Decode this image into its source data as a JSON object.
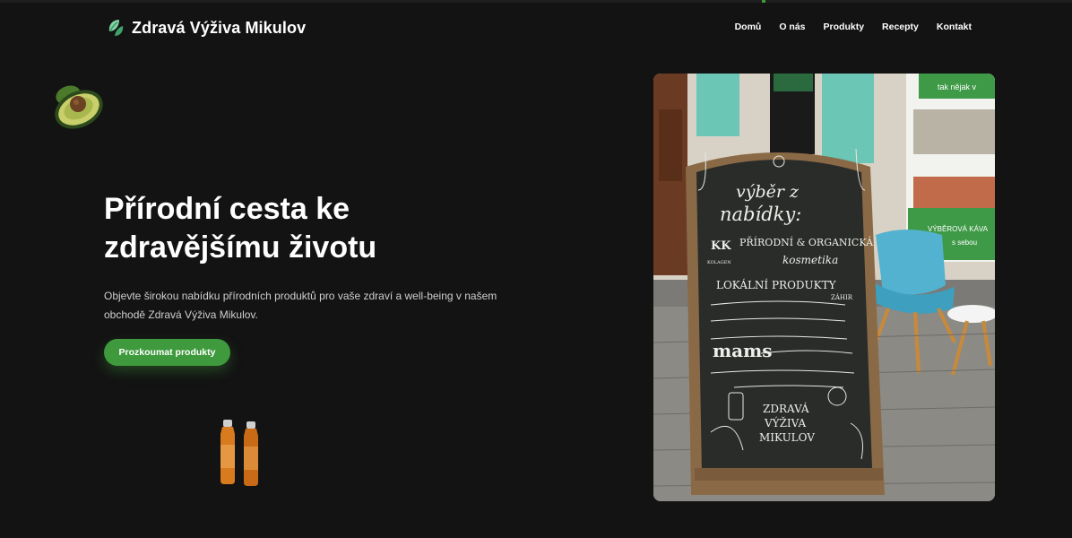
{
  "header": {
    "logo_text": "Zdravá Výživa Mikulov",
    "logo_icon": "leaf-icon",
    "nav": [
      {
        "label": "Domů"
      },
      {
        "label": "O nás"
      },
      {
        "label": "Produkty"
      },
      {
        "label": "Recepty"
      },
      {
        "label": "Kontakt"
      }
    ]
  },
  "hero": {
    "title_line1": "Přírodní cesta ke",
    "title_line2": "zdravějšímu životu",
    "subtitle": "Objevte širokou nabídku přírodních produktů pro vaše zdraví a well-being v našem obchodě Zdravá Výživa Mikulov.",
    "cta_label": "Prozkoumat produkty"
  },
  "photo": {
    "board_lines": [
      "výběr z",
      "nabídky:",
      "PŘÍRODNÍ & ORGANICKÁ",
      "kosmetika",
      "LOKÁLNÍ PRODUKTY",
      "mams",
      "ZDRAVÁ",
      "VÝŽIVA",
      "MIKULOV"
    ],
    "board_logo_left": "KK",
    "board_logo_left_caption": "KOLAGEN",
    "board_logo_right_caption": "ZÁHIR",
    "window_text_1": "tak nějak v",
    "window_text_2": "VÝBĚROVÁ KÁVA",
    "window_text_3": "s sebou"
  },
  "colors": {
    "background": "#131313",
    "accent": "#3e9a3c",
    "text": "#ffffff",
    "muted_text": "#cfcfcf"
  }
}
